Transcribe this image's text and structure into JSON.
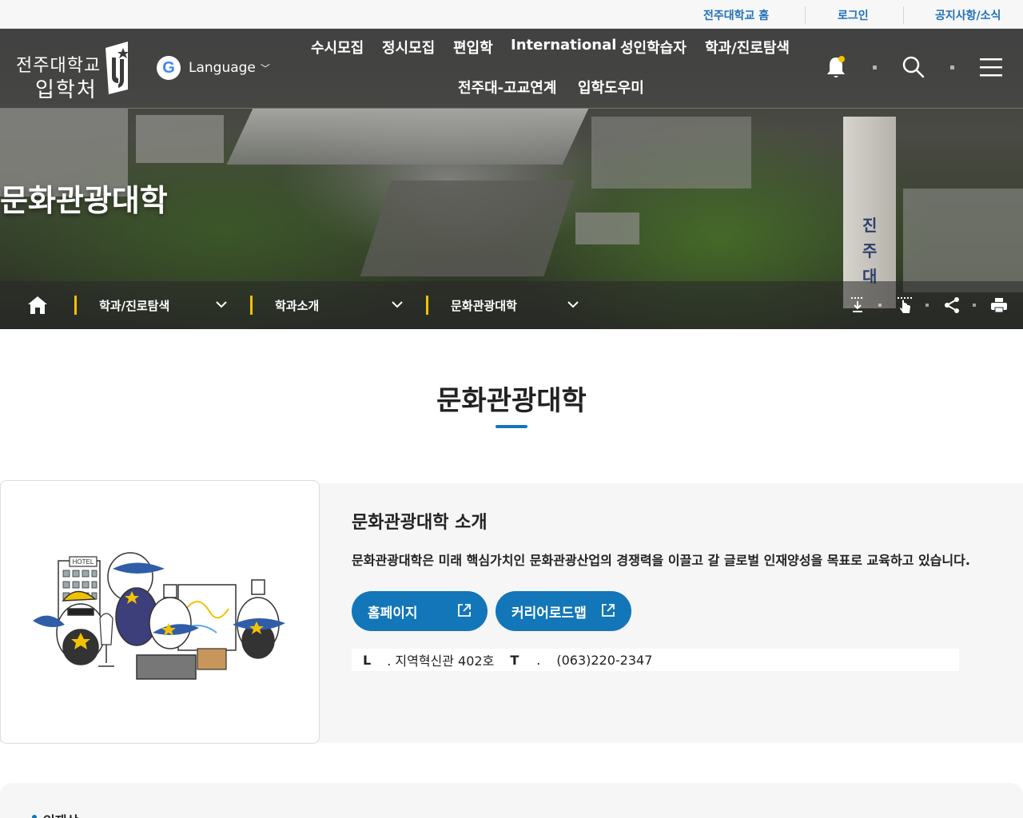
{
  "topbar": {
    "links": [
      "전주대학교 홈",
      "로그인",
      "공지사항/소식"
    ]
  },
  "header": {
    "logo_line1": "전주대학교",
    "logo_line2": "입학처",
    "language_label": "Language",
    "menu_row1": [
      "수시모집",
      "정시모집",
      "편입학",
      "International",
      "성인학습자",
      "학과/진로탐색"
    ],
    "menu_row2": [
      "전주대-고교연계",
      "입학도우미"
    ]
  },
  "hero": {
    "title": "문화관광대학",
    "tower_text": [
      "진",
      "주",
      "대"
    ]
  },
  "location": {
    "items": [
      "학과/진로탐색",
      "학과소개",
      "문화관광대학"
    ]
  },
  "main": {
    "title": "문화관광대학",
    "intro_title": "문화관광대학 소개",
    "intro_desc": "문화관광대학은 미래 핵심가치인 문화관광산업의 경쟁력을 이끌고 갈 글로벌 인재양성을 목표로 교육하고 있습니다.",
    "buttons": [
      "홈페이지",
      "커리어로드맵"
    ],
    "info": {
      "location_key": "L",
      "location_value": ". 지역혁신관 402호",
      "tel_key": "T",
      "tel_value": "(063)220-2347"
    },
    "illustration_sign": "HOTEL",
    "next_section_title": "인재상"
  },
  "colors": {
    "primary": "#1276b8",
    "link": "#1f6fb8",
    "accent": "#f2c200"
  }
}
